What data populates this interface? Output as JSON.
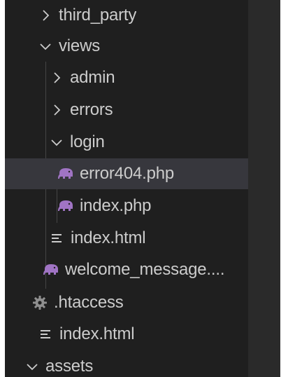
{
  "tree": {
    "items": [
      {
        "label": "third_party",
        "kind": "folder",
        "expanded": false
      },
      {
        "label": "views",
        "kind": "folder",
        "expanded": true
      },
      {
        "label": "admin",
        "kind": "folder",
        "expanded": false
      },
      {
        "label": "errors",
        "kind": "folder",
        "expanded": false
      },
      {
        "label": "login",
        "kind": "folder",
        "expanded": true
      },
      {
        "label": "error404.php",
        "kind": "php",
        "selected": true
      },
      {
        "label": "index.php",
        "kind": "php"
      },
      {
        "label": "index.html",
        "kind": "html"
      },
      {
        "label": "welcome_message....",
        "kind": "php"
      },
      {
        "label": ".htaccess",
        "kind": "config"
      },
      {
        "label": "index.html",
        "kind": "html"
      },
      {
        "label": "assets",
        "kind": "folder",
        "expanded": true
      }
    ]
  },
  "colors": {
    "background": "#1f1f1f",
    "selected_row": "#37373d",
    "text": "#cccccc",
    "php_icon": "#a074c4",
    "guide": "#454545"
  }
}
